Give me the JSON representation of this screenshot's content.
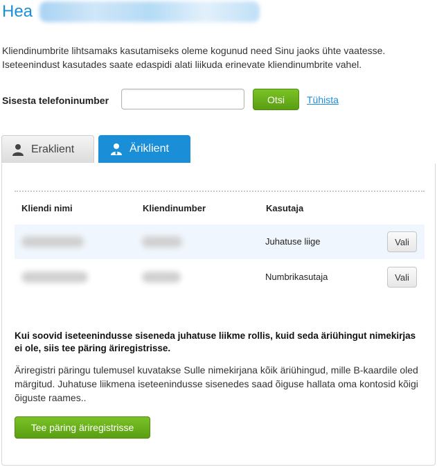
{
  "header": {
    "greeting": "Hea"
  },
  "intro": {
    "line1": "Kliendinumbrite lihtsamaks kasutamiseks oleme kogunud need Sinu jaoks ühte vaatesse.",
    "line2": "Iseteenindust kasutades saate edaspidi alati liikuda erinevate kliendinumbrite vahel."
  },
  "search": {
    "label": "Sisesta telefoninumber",
    "value": "",
    "placeholder": "",
    "button_label": "Otsi",
    "clear_label": "Tühista"
  },
  "tabs": [
    {
      "label": "Eraklient",
      "icon": "person-icon",
      "active": false
    },
    {
      "label": "Äriklient",
      "icon": "business-person-icon",
      "active": true
    }
  ],
  "table": {
    "columns": [
      "Kliendi nimi",
      "Kliendinumber",
      "Kasutaja"
    ],
    "rows": [
      {
        "role": "Juhatuse liige",
        "button": "Vali"
      },
      {
        "role": "Numbrikasutaja",
        "button": "Vali"
      }
    ]
  },
  "notice": {
    "title": "Kui soovid iseteenindusse siseneda juhatuse liikme rollis, kuid seda äriühingut nimekirjas ei ole, siis tee päring äriregistrisse.",
    "body": "Äriregistri päringu tulemusel kuvatakse Sulle nimekirjana kõik äriühingud, mille B-kaardile oled märgitud. Juhatuse liikmena iseteenindusse sisenedes saad õiguse hallata oma kontosid kõigi õiguste raames..",
    "button_label": "Tee päring äriregistrisse"
  },
  "colors": {
    "accent": "#1a8fd8",
    "button_green": "#66ad1a"
  }
}
